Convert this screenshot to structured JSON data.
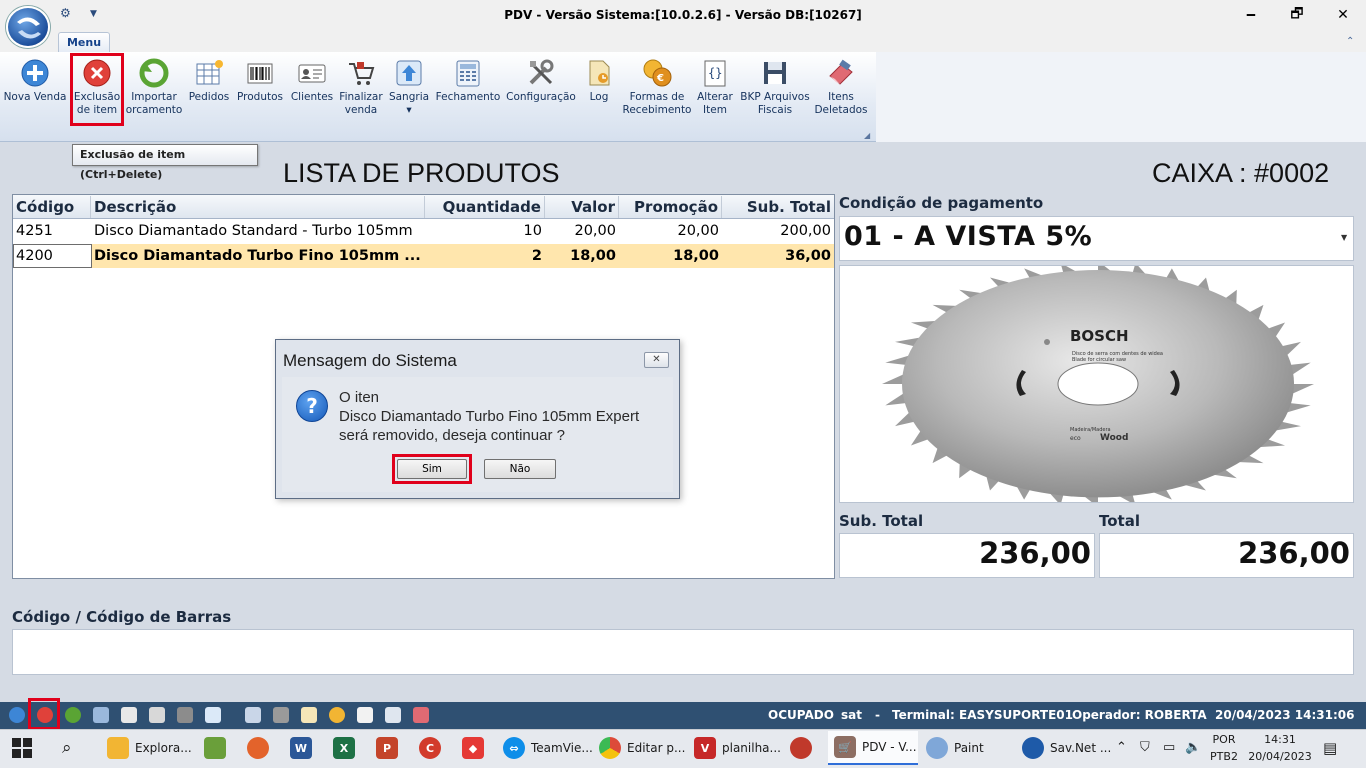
{
  "window": {
    "title": "PDV - Versão Sistema:[10.0.2.6] - Versão DB:[10267]",
    "minimize_glyph": "🗕",
    "maximize_glyph": "🗗",
    "close_glyph": "✕"
  },
  "ribbon": {
    "tab_label": "Menu",
    "buttons": [
      {
        "label1": "Nova Venda",
        "label2": "",
        "icon": "plus-icon"
      },
      {
        "label1": "Exclusão",
        "label2": "de item",
        "icon": "delete-icon"
      },
      {
        "label1": "Importar",
        "label2": "orcamento",
        "icon": "refresh-icon"
      },
      {
        "label1": "Pedidos",
        "label2": "",
        "icon": "table-icon"
      },
      {
        "label1": "Produtos",
        "label2": "",
        "icon": "barcode-icon"
      },
      {
        "label1": "Clientes",
        "label2": "",
        "icon": "id-card-icon"
      },
      {
        "label1": "Finalizar",
        "label2": "venda",
        "icon": "cart-icon"
      },
      {
        "label1": "Sangria",
        "label2": "▾",
        "icon": "upload-icon"
      },
      {
        "label1": "Fechamento",
        "label2": "",
        "icon": "calculator-icon"
      },
      {
        "label1": "Configuração",
        "label2": "",
        "icon": "tools-icon"
      },
      {
        "label1": "Log",
        "label2": "",
        "icon": "log-icon"
      },
      {
        "label1": "Formas de",
        "label2": "Recebimento",
        "icon": "coins-icon"
      },
      {
        "label1": "Alterar",
        "label2": "Item",
        "icon": "edit-icon"
      },
      {
        "label1": "BKP Arquivos",
        "label2": "Fiscais",
        "icon": "floppy-icon"
      },
      {
        "label1": "Itens",
        "label2": "Deletados",
        "icon": "eraser-icon"
      }
    ],
    "tooltip": "Exclusão de item (Ctrl+Delete)"
  },
  "headings": {
    "lista": "LISTA DE PRODUTOS",
    "caixa": "CAIXA : #0002"
  },
  "grid": {
    "columns": [
      "Código",
      "Descrição",
      "Quantidade",
      "Valor",
      "Promoção",
      "Sub. Total"
    ],
    "rows": [
      {
        "codigo": "4251",
        "descricao": "Disco Diamantado Standard - Turbo 105mm",
        "quantidade": "10",
        "valor": "20,00",
        "promocao": "20,00",
        "subtotal": "200,00"
      },
      {
        "codigo": "4200",
        "descricao": "Disco Diamantado Turbo Fino 105mm ...",
        "quantidade": "2",
        "valor": "18,00",
        "promocao": "18,00",
        "subtotal": "36,00"
      }
    ]
  },
  "dialog": {
    "title": "Mensagem do Sistema",
    "line1": "O iten",
    "line2": "Disco Diamantado Turbo Fino 105mm Expert",
    "line3": "será removido, deseja continuar ?",
    "yes": "Sim",
    "no": "Não",
    "close_glyph": "✕",
    "question_glyph": "?"
  },
  "payment": {
    "label": "Condição de pagamento",
    "value": "01 - A VISTA 5%"
  },
  "blade": {
    "brand": "BOSCH",
    "line1": "Disco de serra com dentes de widea",
    "line2": "Blade for circular saw",
    "wood1": "Madeira/Madera",
    "wood2": "Wood",
    "eco": "eco"
  },
  "totals": {
    "subtotal_label": "Sub. Total",
    "subtotal_value": "236,00",
    "total_label": "Total",
    "total_value": "236,00"
  },
  "barcode": {
    "label": "Código / Código de Barras",
    "value": ""
  },
  "status": {
    "state": "OCUPADO",
    "user": "sat",
    "sep": "-",
    "terminal": "Terminal: EASYSUPORTE01",
    "operator": "Operador: ROBERTA",
    "datetime": "20/04/2023 14:31:06"
  },
  "taskbar": {
    "items": [
      {
        "label": "Explora...",
        "icon": "folder-icon",
        "color": "#f2b533"
      },
      {
        "label": "",
        "icon": "chart-app-icon",
        "color": "#6a9f3a"
      },
      {
        "label": "",
        "icon": "firefox-icon",
        "color": "#e3632b"
      },
      {
        "label": "",
        "icon": "word-icon",
        "color": "#2b5797"
      },
      {
        "label": "",
        "icon": "excel-icon",
        "color": "#1e7145"
      },
      {
        "label": "",
        "icon": "powerpoint-icon",
        "color": "#c4442a"
      },
      {
        "label": "",
        "icon": "ccleaner-icon",
        "color": "#d23b2b"
      },
      {
        "label": "",
        "icon": "anydesk-icon",
        "color": "#e53935"
      },
      {
        "label": "TeamVie...",
        "icon": "teamviewer-icon",
        "color": "#0e8ee9"
      },
      {
        "label": "Editar p...",
        "icon": "chrome-icon",
        "color": "#dd4b39"
      },
      {
        "label": "planilha...",
        "icon": "sheet-app-icon",
        "color": "#c62828"
      },
      {
        "label": "",
        "icon": "app-icon",
        "color": "#c0392b"
      },
      {
        "label": "PDV - V...",
        "icon": "cart-icon",
        "color": "#8d6e63"
      },
      {
        "label": "Paint",
        "icon": "paint-icon",
        "color": "#7fa7d8"
      },
      {
        "label": "Sav.Net ...",
        "icon": "savnet-icon",
        "color": "#1e5aa8"
      }
    ],
    "lang1": "POR",
    "lang2": "PTB2",
    "time": "14:31",
    "date": "20/04/2023"
  },
  "colors": {
    "highlight_red": "#e0001b",
    "status_bar": "#2f5072",
    "selected_row": "#ffe6ad"
  }
}
